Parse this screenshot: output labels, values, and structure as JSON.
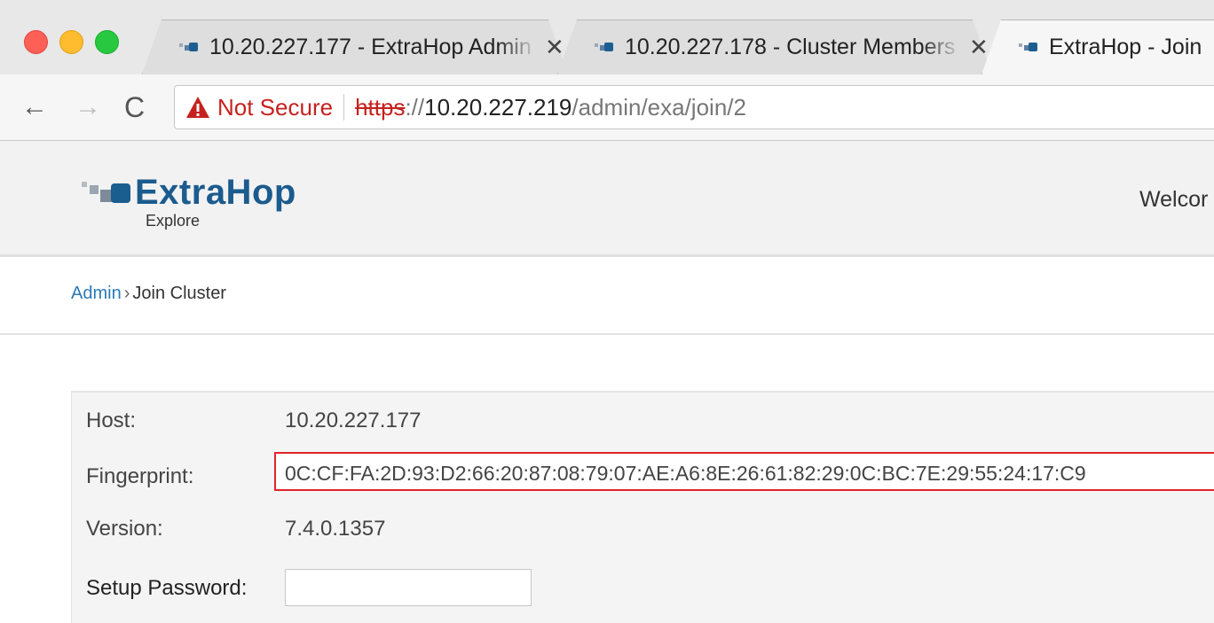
{
  "browser": {
    "tabs": [
      {
        "label": "10.20.227.177 - ExtraHop Admin",
        "close": "✕"
      },
      {
        "label": "10.20.227.178 - Cluster Members",
        "close": "✕"
      },
      {
        "label": "ExtraHop - Join"
      }
    ],
    "nav": {
      "back": "←",
      "forward": "→",
      "reload": "C"
    },
    "address": {
      "security_label": "Not Secure",
      "scheme": "https",
      "scheme_sep": "://",
      "host": "10.20.227.219",
      "path": "/admin/exa/join/2"
    },
    "colors": {
      "insecure": "#c5221f"
    }
  },
  "header": {
    "logo_name": "ExtraHop",
    "logo_sub": "Explore",
    "welcome": "Welcor",
    "brand_color": "#1b5b8e"
  },
  "breadcrumb": {
    "admin": "Admin",
    "separator": "›",
    "current": "Join Cluster"
  },
  "details": {
    "host_label": "Host:",
    "host_value": "10.20.227.177",
    "fingerprint_label": "Fingerprint:",
    "fingerprint_value": "0C:CF:FA:2D:93:D2:66:20:87:08:79:07:AE:A6:8E:26:61:82:29:0C:BC:7E:29:55:24:17:C9",
    "version_label": "Version:",
    "version_value": "7.4.0.1357",
    "password_label": "Setup Password:",
    "password_value": ""
  }
}
